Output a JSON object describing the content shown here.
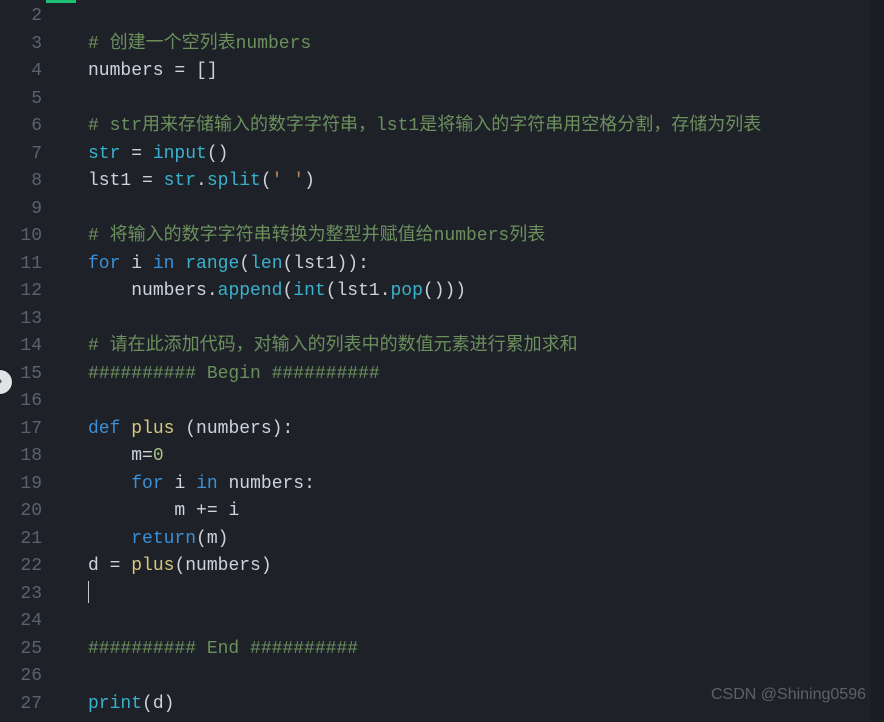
{
  "editor": {
    "language": "python",
    "first_visible_line": 2,
    "last_visible_line": 27,
    "cursor_line": 23,
    "lines": {
      "2": "",
      "3": "    # 创建一个空列表numbers",
      "4": "    numbers = []",
      "5": "",
      "6": "    # str用来存储输入的数字字符串，lst1是将输入的字符串用空格分割，存储为列表",
      "7": "    str = input()",
      "8": "    lst1 = str.split(' ')",
      "9": "",
      "10": "    # 将输入的数字字符串转换为整型并赋值给numbers列表",
      "11": "    for i in range(len(lst1)):",
      "12": "        numbers.append(int(lst1.pop()))",
      "13": "",
      "14": "    # 请在此添加代码，对输入的列表中的数值元素进行累加求和",
      "15": "    ########## Begin ##########",
      "16": "",
      "17": "    def plus (numbers):",
      "18": "        m=0",
      "19": "        for i in numbers:",
      "20": "            m += i",
      "21": "        return(m)",
      "22": "    d = plus(numbers)",
      "23": "    ",
      "24": "",
      "25": "    ########## End ##########",
      "26": "",
      "27": "    print(d)"
    },
    "gutter": {
      "2": "2",
      "3": "3",
      "4": "4",
      "5": "5",
      "6": "6",
      "7": "7",
      "8": "8",
      "9": "9",
      "10": "10",
      "11": "11",
      "12": "12",
      "13": "13",
      "14": "14",
      "15": "15",
      "16": "16",
      "17": "17",
      "18": "18",
      "19": "19",
      "20": "20",
      "21": "21",
      "22": "22",
      "23": "23",
      "24": "24",
      "25": "25",
      "26": "26",
      "27": "27"
    },
    "tokens": {
      "3": [
        [
          "cmt",
          "# 创建一个空列表numbers"
        ]
      ],
      "4": [
        [
          "name",
          "numbers"
        ],
        [
          "op",
          " = []"
        ]
      ],
      "6": [
        [
          "cmt",
          "# str用来存储输入的数字字符串，lst1是将输入的字符串用空格分割，存储为列表"
        ]
      ],
      "7": [
        [
          "fn",
          "str"
        ],
        [
          "op",
          " = "
        ],
        [
          "fn",
          "input"
        ],
        [
          "op",
          "()"
        ]
      ],
      "8": [
        [
          "name",
          "lst1"
        ],
        [
          "op",
          " = "
        ],
        [
          "fn",
          "str"
        ],
        [
          "op",
          "."
        ],
        [
          "fn",
          "split"
        ],
        [
          "op",
          "("
        ],
        [
          "str",
          "' '"
        ],
        [
          "op",
          ")"
        ]
      ],
      "10": [
        [
          "cmt",
          "# 将输入的数字字符串转换为整型并赋值给numbers列表"
        ]
      ],
      "11": [
        [
          "kw",
          "for"
        ],
        [
          "op",
          " "
        ],
        [
          "name",
          "i"
        ],
        [
          "op",
          " "
        ],
        [
          "kw",
          "in"
        ],
        [
          "op",
          " "
        ],
        [
          "fn",
          "range"
        ],
        [
          "op",
          "("
        ],
        [
          "fn",
          "len"
        ],
        [
          "op",
          "(lst1)):"
        ]
      ],
      "12": [
        [
          "op",
          "    "
        ],
        [
          "name",
          "numbers"
        ],
        [
          "op",
          "."
        ],
        [
          "fn",
          "append"
        ],
        [
          "op",
          "("
        ],
        [
          "fn",
          "int"
        ],
        [
          "op",
          "(lst1."
        ],
        [
          "fn",
          "pop"
        ],
        [
          "op",
          "()))"
        ]
      ],
      "14": [
        [
          "cmt",
          "# 请在此添加代码，对输入的列表中的数值元素进行累加求和"
        ]
      ],
      "15": [
        [
          "cmt",
          "########## Begin ##########"
        ]
      ],
      "17": [
        [
          "kw",
          "def"
        ],
        [
          "op",
          " "
        ],
        [
          "def",
          "plus"
        ],
        [
          "op",
          " ("
        ],
        [
          "name",
          "numbers"
        ],
        [
          "op",
          "):"
        ]
      ],
      "18": [
        [
          "op",
          "    "
        ],
        [
          "name",
          "m"
        ],
        [
          "op",
          "="
        ],
        [
          "num",
          "0"
        ]
      ],
      "19": [
        [
          "op",
          "    "
        ],
        [
          "kw",
          "for"
        ],
        [
          "op",
          " "
        ],
        [
          "name",
          "i"
        ],
        [
          "op",
          " "
        ],
        [
          "kw",
          "in"
        ],
        [
          "op",
          " "
        ],
        [
          "name",
          "numbers"
        ],
        [
          "op",
          ":"
        ]
      ],
      "20": [
        [
          "op",
          "        "
        ],
        [
          "name",
          "m"
        ],
        [
          "op",
          " += "
        ],
        [
          "name",
          "i"
        ]
      ],
      "21": [
        [
          "op",
          "    "
        ],
        [
          "kw",
          "return"
        ],
        [
          "op",
          "("
        ],
        [
          "name",
          "m"
        ],
        [
          "op",
          ")"
        ]
      ],
      "22": [
        [
          "name",
          "d"
        ],
        [
          "op",
          " = "
        ],
        [
          "def",
          "plus"
        ],
        [
          "op",
          "("
        ],
        [
          "name",
          "numbers"
        ],
        [
          "op",
          ")"
        ]
      ],
      "25": [
        [
          "cmt",
          "########## End ##########"
        ]
      ],
      "27": [
        [
          "fn",
          "print"
        ],
        [
          "op",
          "("
        ],
        [
          "name",
          "d"
        ],
        [
          "op",
          ")"
        ]
      ]
    }
  },
  "watermark": "CSDN @Shining0596",
  "icons": {
    "side_arrow": "›"
  }
}
